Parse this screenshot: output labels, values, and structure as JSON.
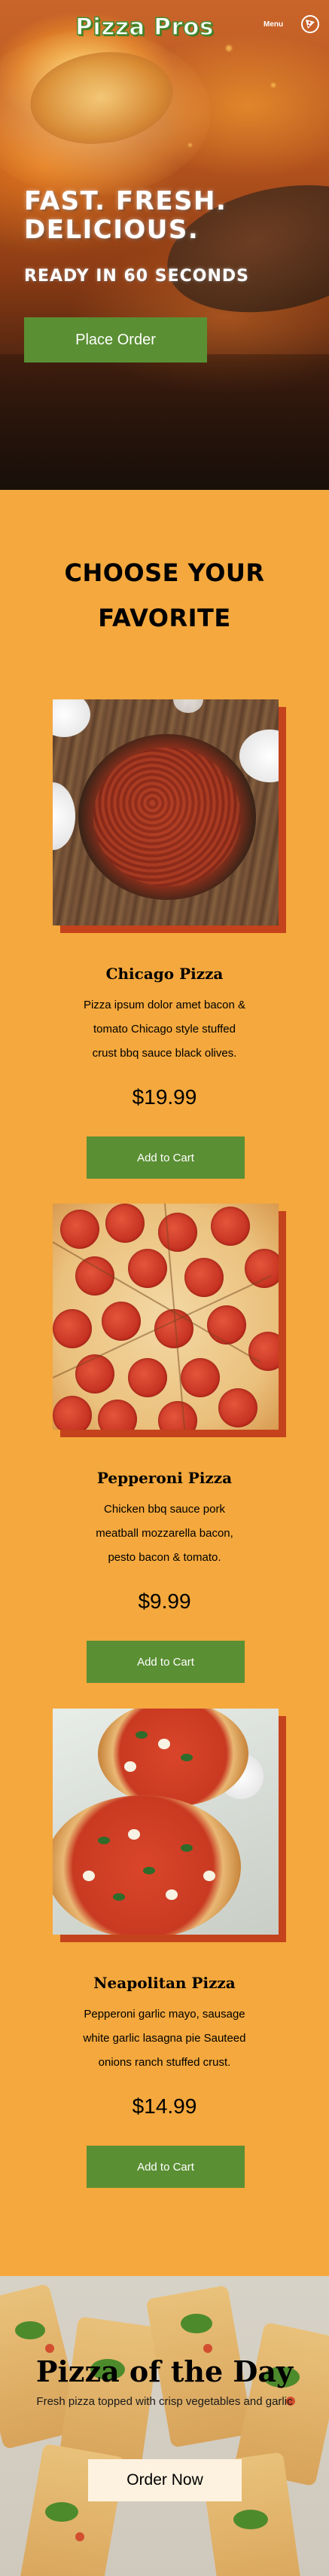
{
  "header": {
    "logo": "Pizza Pros",
    "menu_label": "Menu",
    "menu_icon": "pizza-slice-icon"
  },
  "hero": {
    "headline": "FAST. FRESH. DELICIOUS.",
    "subheadline": "READY IN 60 SECONDS",
    "cta_label": "Place Order"
  },
  "favorites": {
    "title": "CHOOSE YOUR FAVORITE",
    "items": [
      {
        "name": "Chicago Pizza",
        "description_lines": [
          "Pizza ipsum dolor amet bacon &",
          "tomato Chicago style stuffed",
          "crust bbq sauce black olives."
        ],
        "price": "$19.99",
        "button_label": "Add to Cart"
      },
      {
        "name": "Pepperoni Pizza",
        "description_lines": [
          "Chicken bbq sauce pork",
          "meatball mozzarella bacon,",
          "pesto bacon & tomato."
        ],
        "price": "$9.99",
        "button_label": "Add to Cart"
      },
      {
        "name": "Neapolitan Pizza",
        "description_lines": [
          "Pepperoni garlic mayo, sausage",
          "white garlic lasagna pie Sauteed",
          "onions ranch stuffed crust."
        ],
        "price": "$14.99",
        "button_label": "Add to Cart"
      }
    ]
  },
  "pizza_of_the_day": {
    "title": "Pizza of the Day",
    "description": "Fresh pizza topped with crisp vegetables and garlic",
    "button_label": "Order Now"
  },
  "colors": {
    "background": "#f4a83d",
    "accent_green": "#5a8f33",
    "card_shadow": "#c4421c",
    "order_now_bg": "#fdf2df"
  }
}
